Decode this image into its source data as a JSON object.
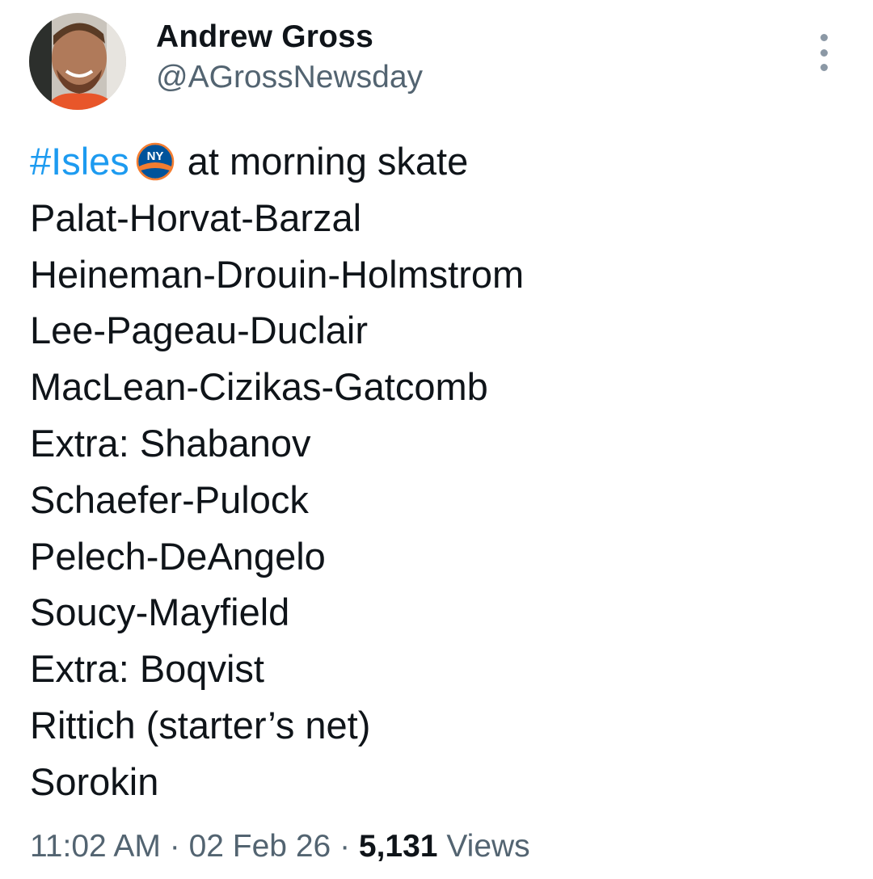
{
  "author": {
    "display_name": "Andrew Gross",
    "handle": "@AGrossNewsday"
  },
  "tweet": {
    "hashtag": "#Isles",
    "emoji_icon": "new-york-islanders-logo",
    "first_line_rest": "at morning skate",
    "lines": [
      "Palat-Horvat-Barzal",
      "Heineman-Drouin-Holmstrom",
      "Lee-Pageau-Duclair",
      "MacLean-Cizikas-Gatcomb",
      "Extra: Shabanov",
      "Schaefer-Pulock",
      "Pelech-DeAngelo",
      "Soucy-Mayfield",
      "Extra: Boqvist",
      "Rittich (starter’s net)",
      "Sorokin"
    ]
  },
  "meta": {
    "time": "11:02 AM",
    "separator": "·",
    "date": "02 Feb 26",
    "views_count": "5,131",
    "views_label": "Views"
  },
  "colors": {
    "hashtag": "#1d9bf0",
    "secondary_text": "#536471",
    "primary_text": "#0f1419"
  }
}
